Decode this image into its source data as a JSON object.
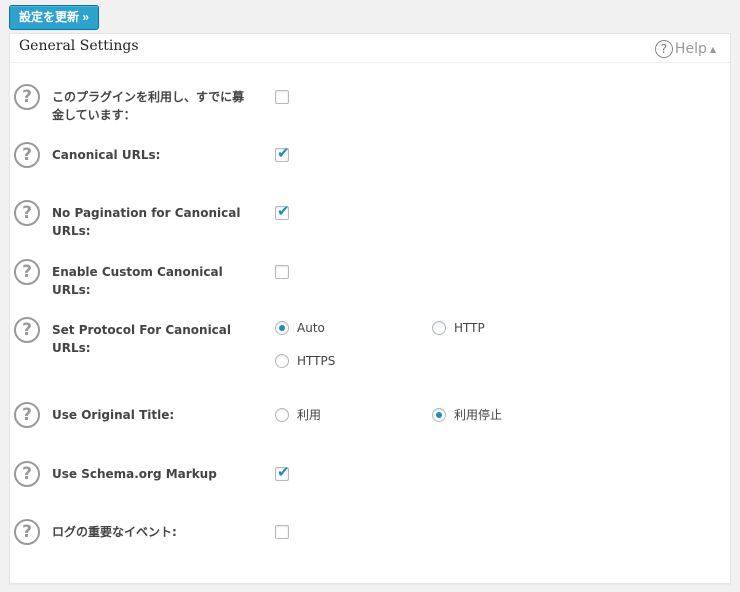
{
  "toolbar": {
    "update_button": "設定を更新 »"
  },
  "panel": {
    "title": "General Settings",
    "help_label": "Help",
    "help_icon": "?",
    "help_caret": "▲"
  },
  "rows": [
    {
      "label": "このプラグインを利用し、すでに募金しています：",
      "type": "checkbox",
      "checked": false
    },
    {
      "label": "Canonical URLs:",
      "type": "checkbox",
      "checked": true
    },
    {
      "label": "No Pagination for Canonical URLs:",
      "type": "checkbox",
      "checked": true
    },
    {
      "label": "Enable Custom Canonical URLs:",
      "type": "checkbox",
      "checked": false
    },
    {
      "label": "Set Protocol For Canonical URLs:",
      "type": "radio",
      "options": [
        {
          "label": "Auto",
          "checked": true
        },
        {
          "label": "HTTP",
          "checked": false
        },
        {
          "label": "HTTPS",
          "checked": false
        }
      ]
    },
    {
      "label": "Use Original Title:",
      "type": "radio",
      "options": [
        {
          "label": "利用",
          "checked": false
        },
        {
          "label": "利用停止",
          "checked": true
        }
      ]
    },
    {
      "label": "Use Schema.org Markup",
      "type": "checkbox",
      "checked": true
    },
    {
      "label": "ログの重要なイベント:",
      "type": "checkbox",
      "checked": false
    }
  ],
  "icons": {
    "help_row": "?",
    "check": "✔"
  },
  "colors": {
    "accent": "#2ea2cc",
    "check": "#1e8cbe"
  }
}
